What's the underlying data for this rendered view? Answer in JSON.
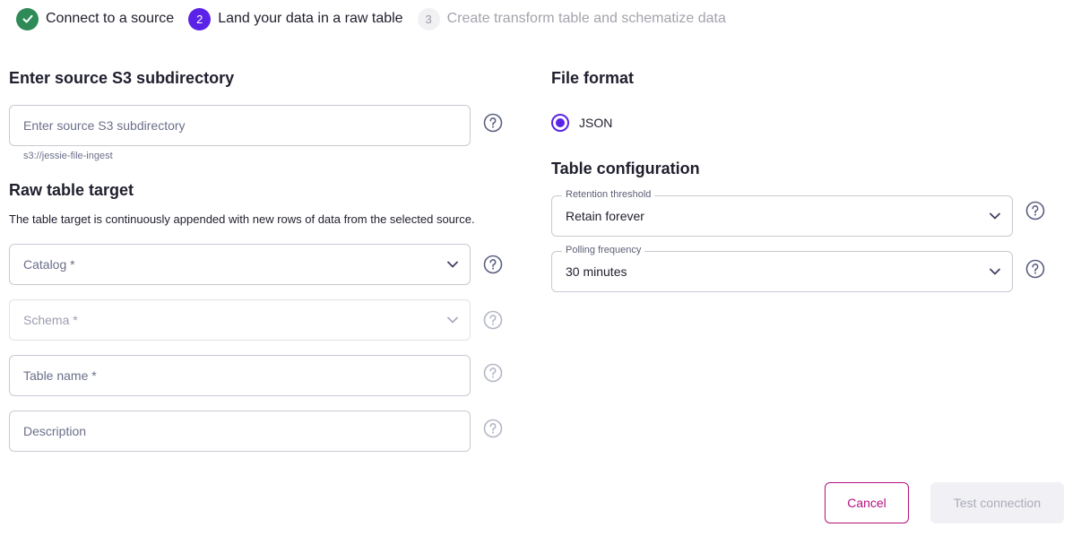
{
  "stepper": {
    "steps": [
      {
        "number": "",
        "label": "Connect to a source",
        "state": "done"
      },
      {
        "number": "2",
        "label": "Land your data in a raw table",
        "state": "active"
      },
      {
        "number": "3",
        "label": "Create transform table and schematize data",
        "state": "todo"
      }
    ]
  },
  "source": {
    "heading": "Enter source S3 subdirectory",
    "input_placeholder": "Enter source S3 subdirectory",
    "hint": "s3://jessie-file-ingest"
  },
  "raw_table": {
    "heading": "Raw table target",
    "description": "The table target is continuously appended with new rows of data from the selected source.",
    "catalog_placeholder": "Catalog *",
    "schema_placeholder": "Schema *",
    "table_name_placeholder": "Table name *",
    "description_placeholder": "Description"
  },
  "file_format": {
    "heading": "File format",
    "option_label": "JSON",
    "selected": true
  },
  "table_config": {
    "heading": "Table configuration",
    "retention_label": "Retention threshold",
    "retention_value": "Retain forever",
    "polling_label": "Polling frequency",
    "polling_value": "30 minutes"
  },
  "actions": {
    "cancel_label": "Cancel",
    "test_label": "Test connection"
  },
  "colors": {
    "accent": "#5b22e8",
    "success": "#2e8b57",
    "cancel": "#b4127e"
  },
  "icons": [
    "check-icon",
    "help-circle-icon",
    "chevron-down-icon"
  ]
}
